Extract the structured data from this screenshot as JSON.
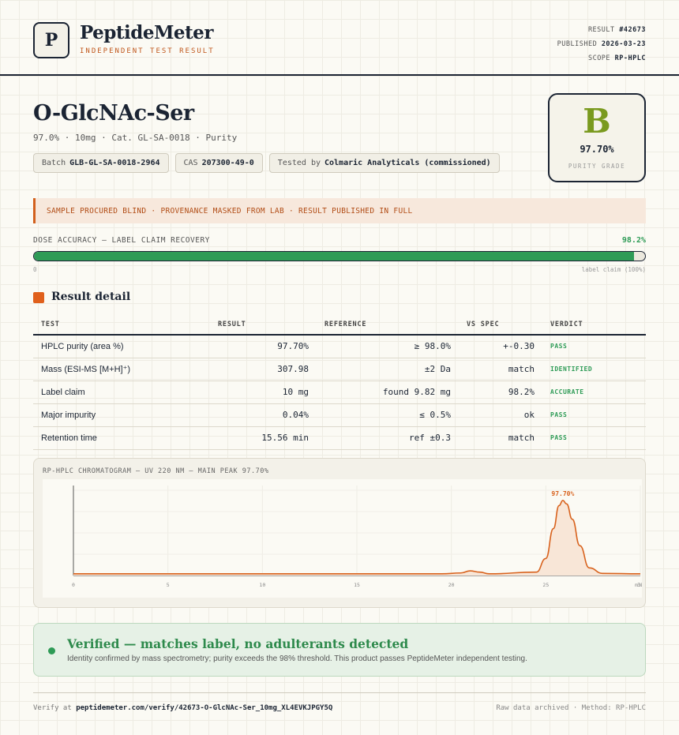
{
  "brand": {
    "logo_letter": "P",
    "name": "PeptideMeter",
    "tagline": "INDEPENDENT TEST RESULT"
  },
  "meta": {
    "result_label": "RESULT",
    "result_value": "#42673",
    "published_label": "PUBLISHED",
    "published_value": "2026-03-23",
    "scope_label": "SCOPE",
    "scope_value": "RP-HPLC"
  },
  "product": {
    "title": "O-GlcNAc-Ser",
    "subline": "97.0% · 10mg · Cat. GL-SA-0018 · Purity",
    "chips": {
      "batch_label": "Batch",
      "batch_value": "GLB-GL-SA-0018-2964",
      "cas_label": "CAS",
      "cas_value": "207300-49-0",
      "tested_label": "Tested by",
      "tested_value": "Colmaric Analyticals (commissioned)"
    }
  },
  "grade": {
    "letter": "B",
    "value": "97.70%",
    "label": "PURITY GRADE",
    "color": "#7a9a1f"
  },
  "banner": {
    "text": "SAMPLE PROCURED BLIND · PROVENANCE MASKED FROM LAB · RESULT PUBLISHED IN FULL"
  },
  "dose": {
    "label": "DOSE ACCURACY — LABEL CLAIM RECOVERY",
    "value": "98.2%",
    "fraction": 0.982,
    "min_label": "0",
    "max_label": "label claim (100%)",
    "color": "#2e9b56"
  },
  "section": {
    "title": "Result detail"
  },
  "table": {
    "headers": [
      "TEST",
      "RESULT",
      "REFERENCE",
      "VS SPEC",
      "VERDICT"
    ],
    "rows": [
      {
        "test": "HPLC purity (area %)",
        "result": "97.70%",
        "reference": "≥ 98.0%",
        "vs_spec": "+-0.30",
        "verdict": "PASS"
      },
      {
        "test": "Mass (ESI-MS [M+H]⁺)",
        "result": "307.98",
        "reference": "±2 Da",
        "vs_spec": "match",
        "verdict": "IDENTIFIED"
      },
      {
        "test": "Label claim",
        "result": "10 mg",
        "reference": "found 9.82 mg",
        "vs_spec": "98.2%",
        "verdict": "ACCURATE"
      },
      {
        "test": "Major impurity",
        "result": "0.04%",
        "reference": "≤ 0.5%",
        "vs_spec": "ok",
        "verdict": "PASS"
      },
      {
        "test": "Retention time",
        "result": "15.56 min",
        "reference": "ref ±0.3",
        "vs_spec": "match",
        "verdict": "PASS"
      }
    ]
  },
  "chart_data": {
    "type": "line",
    "title": "RP-HPLC CHROMATOGRAM — UV 220 NM — MAIN PEAK 97.70%",
    "xlabel": "",
    "ylabel": "",
    "x_ticks": [
      "0",
      "5",
      "10",
      "15",
      "20",
      "25",
      "30"
    ],
    "x_end_label": "min",
    "xlim": [
      0,
      30
    ],
    "peak_label": "97.70%",
    "series": [
      {
        "x": [
          0,
          19.5,
          20.5,
          21.0,
          21.5,
          22.0,
          24.5,
          25.0,
          25.4,
          25.7,
          25.9,
          26.1,
          26.4,
          26.8,
          27.3,
          28.0,
          30
        ],
        "y": [
          2.0,
          2.0,
          3.0,
          5.5,
          4.0,
          2.0,
          4.0,
          20.0,
          55.0,
          82.0,
          88.0,
          84.0,
          66.0,
          35.0,
          9.0,
          2.5,
          2.0
        ]
      }
    ],
    "ylim": [
      0,
      100
    ],
    "color": "#d8621d",
    "fill": "#f8e6d7"
  },
  "verified": {
    "title": "Verified — matches label, no adulterants detected",
    "description": "Identity confirmed by mass spectrometry; purity exceeds the 98% threshold. This product passes PeptideMeter independent testing."
  },
  "footer": {
    "verify_prefix": "Verify at",
    "verify_url": "peptidemeter.com/verify/42673-O-GlcNAc-Ser_10mg_XL4EVKJPGY5Q",
    "right_text": "Raw data archived · Method: RP-HPLC"
  }
}
